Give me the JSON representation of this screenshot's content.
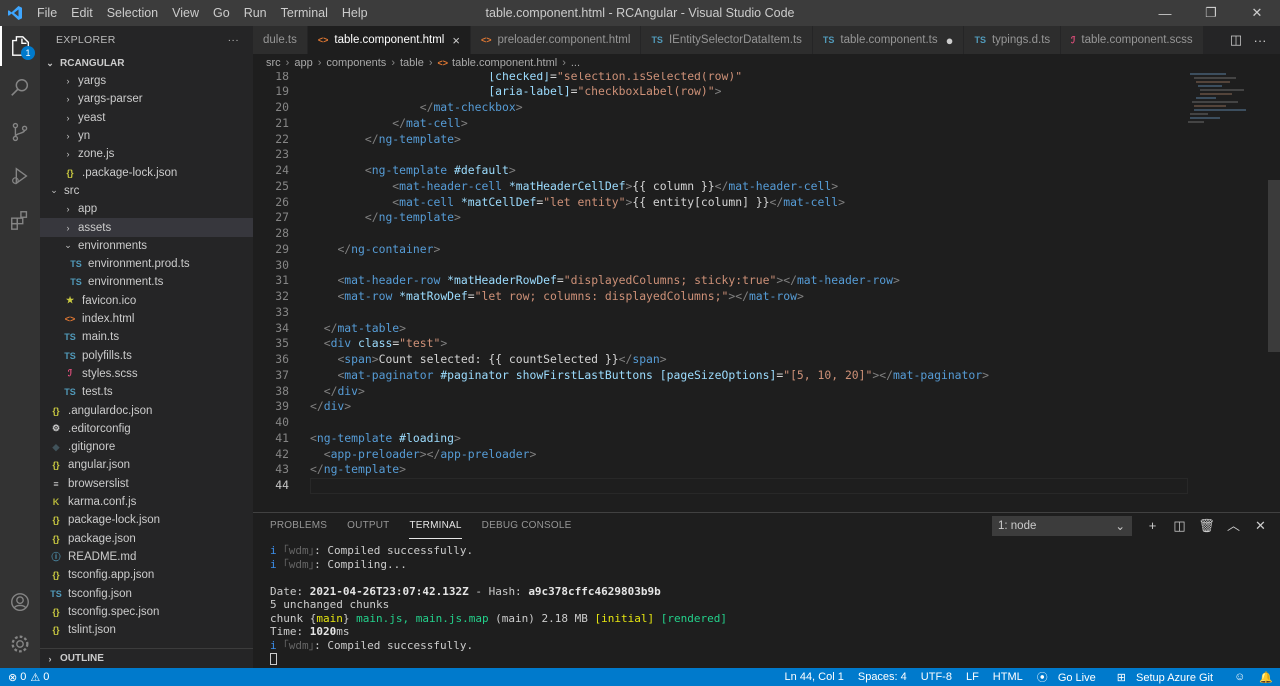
{
  "titlebar": {
    "menu": [
      "File",
      "Edit",
      "Selection",
      "View",
      "Go",
      "Run",
      "Terminal",
      "Help"
    ],
    "title": "table.component.html - RCAngular - Visual Studio Code"
  },
  "activity": {
    "badge": "1"
  },
  "explorer": {
    "header": "EXPLORER",
    "more": "···",
    "project": "RCANGULAR",
    "outline": "OUTLINE",
    "items": [
      {
        "label": "yargs",
        "chev": "›",
        "icon": ""
      },
      {
        "label": "yargs-parser",
        "chev": "›",
        "icon": ""
      },
      {
        "label": "yeast",
        "chev": "›",
        "icon": ""
      },
      {
        "label": "yn",
        "chev": "›",
        "icon": ""
      },
      {
        "label": "zone.js",
        "chev": "›",
        "icon": ""
      },
      {
        "label": ".package-lock.json",
        "chev": "",
        "icon": "{}"
      },
      {
        "label": "src",
        "chev": "⌄",
        "icon": ""
      },
      {
        "label": "app",
        "chev": "›",
        "icon": ""
      },
      {
        "label": "assets",
        "chev": "›",
        "icon": ""
      },
      {
        "label": "environments",
        "chev": "⌄",
        "icon": ""
      },
      {
        "label": "environment.prod.ts",
        "chev": "",
        "icon": "TS"
      },
      {
        "label": "environment.ts",
        "chev": "",
        "icon": "TS"
      },
      {
        "label": "favicon.ico",
        "chev": "",
        "icon": "★"
      },
      {
        "label": "index.html",
        "chev": "",
        "icon": "<>"
      },
      {
        "label": "main.ts",
        "chev": "",
        "icon": "TS"
      },
      {
        "label": "polyfills.ts",
        "chev": "",
        "icon": "TS"
      },
      {
        "label": "styles.scss",
        "chev": "",
        "icon": "ℐ"
      },
      {
        "label": "test.ts",
        "chev": "",
        "icon": "TS"
      },
      {
        "label": ".angulardoc.json",
        "chev": "",
        "icon": "{}"
      },
      {
        "label": ".editorconfig",
        "chev": "",
        "icon": "⚙"
      },
      {
        "label": ".gitignore",
        "chev": "",
        "icon": "◆"
      },
      {
        "label": "angular.json",
        "chev": "",
        "icon": "{}"
      },
      {
        "label": "browserslist",
        "chev": "",
        "icon": "≡"
      },
      {
        "label": "karma.conf.js",
        "chev": "",
        "icon": "K"
      },
      {
        "label": "package-lock.json",
        "chev": "",
        "icon": "{}"
      },
      {
        "label": "package.json",
        "chev": "",
        "icon": "{}"
      },
      {
        "label": "README.md",
        "chev": "",
        "icon": "ⓘ"
      },
      {
        "label": "tsconfig.app.json",
        "chev": "",
        "icon": "{}"
      },
      {
        "label": "tsconfig.json",
        "chev": "",
        "icon": "TS"
      },
      {
        "label": "tsconfig.spec.json",
        "chev": "",
        "icon": "{}"
      },
      {
        "label": "tslint.json",
        "chev": "",
        "icon": "{}"
      }
    ]
  },
  "tabs": [
    {
      "label": "dule.ts",
      "icon": "",
      "state": ""
    },
    {
      "label": "table.component.html",
      "icon": "<>",
      "state": "×"
    },
    {
      "label": "preloader.component.html",
      "icon": "<>",
      "state": ""
    },
    {
      "label": "IEntitySelectorDataItem.ts",
      "icon": "TS",
      "state": ""
    },
    {
      "label": "table.component.ts",
      "icon": "TS",
      "state": "●"
    },
    {
      "label": "typings.d.ts",
      "icon": "TS",
      "state": ""
    },
    {
      "label": "table.component.scss",
      "icon": "ℐ",
      "state": ""
    }
  ],
  "breadcrumb": [
    "src",
    "app",
    "components",
    "table",
    "table.component.html",
    "..."
  ],
  "editor": {
    "lines": [
      {
        "n": "18",
        "segs": [
          [
            "t",
            "                          "
          ],
          [
            "a",
            "[checked]"
          ],
          [
            "t",
            "="
          ],
          [
            "s",
            "\"selection.isSelected(row)\""
          ]
        ]
      },
      {
        "n": "19",
        "segs": [
          [
            "t",
            "                          "
          ],
          [
            "a",
            "[aria-label]"
          ],
          [
            "t",
            "="
          ],
          [
            "s",
            "\"checkboxLabel(row)\""
          ],
          [
            "b",
            ">"
          ]
        ]
      },
      {
        "n": "20",
        "segs": [
          [
            "t",
            "                "
          ],
          [
            "b",
            "</"
          ],
          [
            "g",
            "mat-checkbox"
          ],
          [
            "b",
            ">"
          ]
        ]
      },
      {
        "n": "21",
        "segs": [
          [
            "t",
            "            "
          ],
          [
            "b",
            "</"
          ],
          [
            "g",
            "mat-cell"
          ],
          [
            "b",
            ">"
          ]
        ]
      },
      {
        "n": "22",
        "segs": [
          [
            "t",
            "        "
          ],
          [
            "b",
            "</"
          ],
          [
            "g",
            "ng-template"
          ],
          [
            "b",
            ">"
          ]
        ]
      },
      {
        "n": "23",
        "segs": []
      },
      {
        "n": "24",
        "segs": [
          [
            "t",
            "        "
          ],
          [
            "b",
            "<"
          ],
          [
            "g",
            "ng-template"
          ],
          [
            "t",
            " "
          ],
          [
            "a",
            "#default"
          ],
          [
            "b",
            ">"
          ]
        ]
      },
      {
        "n": "25",
        "segs": [
          [
            "t",
            "            "
          ],
          [
            "b",
            "<"
          ],
          [
            "g",
            "mat-header-cell"
          ],
          [
            "t",
            " "
          ],
          [
            "a",
            "*matHeaderCellDef"
          ],
          [
            "b",
            ">"
          ],
          [
            "t",
            "{{ column }}"
          ],
          [
            "b",
            "</"
          ],
          [
            "g",
            "mat-header-cell"
          ],
          [
            "b",
            ">"
          ]
        ]
      },
      {
        "n": "26",
        "segs": [
          [
            "t",
            "            "
          ],
          [
            "b",
            "<"
          ],
          [
            "g",
            "mat-cell"
          ],
          [
            "t",
            " "
          ],
          [
            "a",
            "*matCellDef"
          ],
          [
            "t",
            "="
          ],
          [
            "s",
            "\"let entity\""
          ],
          [
            "b",
            ">"
          ],
          [
            "t",
            "{{ entity[column] }}"
          ],
          [
            "b",
            "</"
          ],
          [
            "g",
            "mat-cell"
          ],
          [
            "b",
            ">"
          ]
        ]
      },
      {
        "n": "27",
        "segs": [
          [
            "t",
            "        "
          ],
          [
            "b",
            "</"
          ],
          [
            "g",
            "ng-template"
          ],
          [
            "b",
            ">"
          ]
        ]
      },
      {
        "n": "28",
        "segs": []
      },
      {
        "n": "29",
        "segs": [
          [
            "t",
            "    "
          ],
          [
            "b",
            "</"
          ],
          [
            "g",
            "ng-container"
          ],
          [
            "b",
            ">"
          ]
        ]
      },
      {
        "n": "30",
        "segs": []
      },
      {
        "n": "31",
        "segs": [
          [
            "t",
            "    "
          ],
          [
            "b",
            "<"
          ],
          [
            "g",
            "mat-header-row"
          ],
          [
            "t",
            " "
          ],
          [
            "a",
            "*matHeaderRowDef"
          ],
          [
            "t",
            "="
          ],
          [
            "s",
            "\"displayedColumns; sticky:true\""
          ],
          [
            "b",
            "></"
          ],
          [
            "g",
            "mat-header-row"
          ],
          [
            "b",
            ">"
          ]
        ]
      },
      {
        "n": "32",
        "segs": [
          [
            "t",
            "    "
          ],
          [
            "b",
            "<"
          ],
          [
            "g",
            "mat-row"
          ],
          [
            "t",
            " "
          ],
          [
            "a",
            "*matRowDef"
          ],
          [
            "t",
            "="
          ],
          [
            "s",
            "\"let row; columns: displayedColumns;\""
          ],
          [
            "b",
            "></"
          ],
          [
            "g",
            "mat-row"
          ],
          [
            "b",
            ">"
          ]
        ]
      },
      {
        "n": "33",
        "segs": []
      },
      {
        "n": "34",
        "segs": [
          [
            "t",
            "  "
          ],
          [
            "b",
            "</"
          ],
          [
            "g",
            "mat-table"
          ],
          [
            "b",
            ">"
          ]
        ]
      },
      {
        "n": "35",
        "segs": [
          [
            "t",
            "  "
          ],
          [
            "b",
            "<"
          ],
          [
            "g",
            "div"
          ],
          [
            "t",
            " "
          ],
          [
            "a",
            "class"
          ],
          [
            "t",
            "="
          ],
          [
            "s",
            "\"test\""
          ],
          [
            "b",
            ">"
          ]
        ]
      },
      {
        "n": "36",
        "segs": [
          [
            "t",
            "    "
          ],
          [
            "b",
            "<"
          ],
          [
            "g",
            "span"
          ],
          [
            "b",
            ">"
          ],
          [
            "t",
            "Count selected: {{ countSelected }}"
          ],
          [
            "b",
            "</"
          ],
          [
            "g",
            "span"
          ],
          [
            "b",
            ">"
          ]
        ]
      },
      {
        "n": "37",
        "segs": [
          [
            "t",
            "    "
          ],
          [
            "b",
            "<"
          ],
          [
            "g",
            "mat-paginator"
          ],
          [
            "t",
            " "
          ],
          [
            "a",
            "#paginator"
          ],
          [
            "t",
            " "
          ],
          [
            "a",
            "showFirstLastButtons"
          ],
          [
            "t",
            " "
          ],
          [
            "a",
            "[pageSizeOptions]"
          ],
          [
            "t",
            "="
          ],
          [
            "s",
            "\"[5, 10, 20]\""
          ],
          [
            "b",
            "></"
          ],
          [
            "g",
            "mat-paginator"
          ],
          [
            "b",
            ">"
          ]
        ]
      },
      {
        "n": "38",
        "segs": [
          [
            "t",
            "  "
          ],
          [
            "b",
            "</"
          ],
          [
            "g",
            "div"
          ],
          [
            "b",
            ">"
          ]
        ]
      },
      {
        "n": "39",
        "segs": [
          [
            "b",
            "</"
          ],
          [
            "g",
            "div"
          ],
          [
            "b",
            ">"
          ]
        ]
      },
      {
        "n": "40",
        "segs": []
      },
      {
        "n": "41",
        "segs": [
          [
            "b",
            "<"
          ],
          [
            "g",
            "ng-template"
          ],
          [
            "t",
            " "
          ],
          [
            "a",
            "#loading"
          ],
          [
            "b",
            ">"
          ]
        ]
      },
      {
        "n": "42",
        "segs": [
          [
            "t",
            "  "
          ],
          [
            "b",
            "<"
          ],
          [
            "g",
            "app-preloader"
          ],
          [
            "b",
            "></"
          ],
          [
            "g",
            "app-preloader"
          ],
          [
            "b",
            ">"
          ]
        ]
      },
      {
        "n": "43",
        "segs": [
          [
            "b",
            "</"
          ],
          [
            "g",
            "ng-template"
          ],
          [
            "b",
            ">"
          ]
        ]
      },
      {
        "n": "44",
        "segs": []
      }
    ]
  },
  "panel": {
    "tabs": [
      "PROBLEMS",
      "OUTPUT",
      "TERMINAL",
      "DEBUG CONSOLE"
    ],
    "terminal_select": "1: node",
    "terminal": [
      [
        [
          "c-blue",
          "i"
        ],
        [
          "c-gray",
          " ｢wdm｣"
        ],
        [
          "",
          ": Compiled successfully."
        ]
      ],
      [
        [
          "c-blue",
          "i"
        ],
        [
          "c-gray",
          " ｢wdm｣"
        ],
        [
          "",
          ": Compiling..."
        ]
      ],
      [],
      [
        [
          "",
          "Date: "
        ],
        [
          "c-bold",
          "2021-04-26T23:07:42.132Z"
        ],
        [
          "",
          " - Hash: "
        ],
        [
          "c-bold",
          "a9c378cffc4629803b9b"
        ]
      ],
      [
        [
          "",
          "5 unchanged chunks"
        ]
      ],
      [
        [
          "",
          "chunk {"
        ],
        [
          "c-yel",
          "main"
        ],
        [
          "",
          "} "
        ],
        [
          "c-grn",
          "main.js, main.js.map"
        ],
        [
          "",
          " (main) 2.18 MB "
        ],
        [
          "c-yel",
          "[initial]"
        ],
        [
          "",
          " "
        ],
        [
          "c-grn",
          "[rendered]"
        ]
      ],
      [
        [
          "",
          "Time: "
        ],
        [
          "c-bold",
          "1020"
        ],
        [
          "",
          "ms"
        ]
      ],
      [
        [
          "c-blue",
          "i"
        ],
        [
          "c-gray",
          " ｢wdm｣"
        ],
        [
          "",
          ": Compiled successfully."
        ]
      ]
    ]
  },
  "status": {
    "errors": "0",
    "warnings": "0",
    "position": "Ln 44, Col 1",
    "spaces": "Spaces: 4",
    "encoding": "UTF-8",
    "eol": "LF",
    "language": "HTML",
    "golive": "Go Live",
    "azure": "Setup Azure Git"
  },
  "colors": {
    "accent": "#007acc",
    "ts_icon": "#519aba",
    "html_icon": "#e37933",
    "json_icon": "#cbcb41",
    "scss_icon": "#f55385"
  }
}
